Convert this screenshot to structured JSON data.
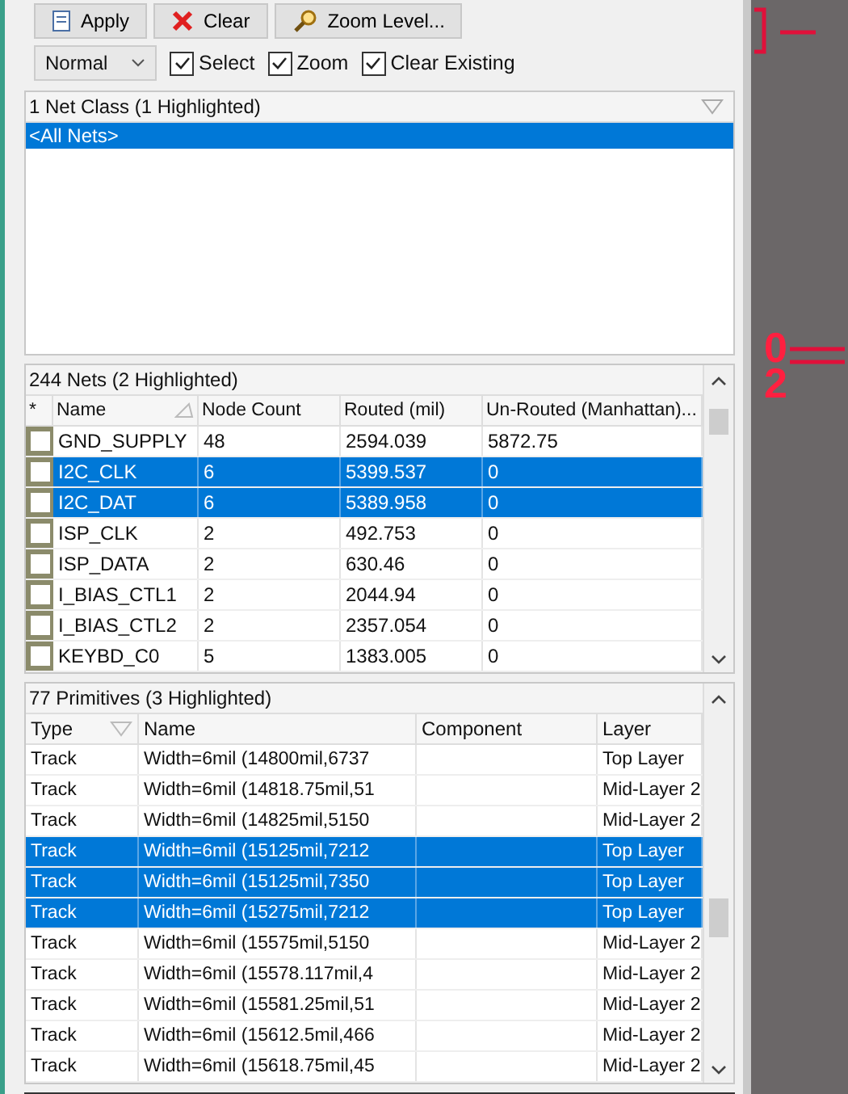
{
  "toolbar": {
    "buttons": [
      {
        "label": "Apply",
        "kind": "apply"
      },
      {
        "label": "Clear",
        "kind": "clear"
      },
      {
        "label": "Zoom Level...",
        "kind": "zoom"
      }
    ]
  },
  "options": {
    "mode": "Normal",
    "checkboxes": [
      {
        "label": "Select",
        "checked": true
      },
      {
        "label": "Zoom",
        "checked": true
      },
      {
        "label": "Clear Existing",
        "checked": true
      }
    ]
  },
  "net_classes": {
    "header": "1 Net Class (1 Highlighted)",
    "items": [
      {
        "name": "<All Nets>",
        "selected": true
      }
    ]
  },
  "nets": {
    "header": "244 Nets (2 Highlighted)",
    "check_column": "*",
    "columns": [
      {
        "label": "Name",
        "sorted": true
      },
      {
        "label": "Node Count",
        "sorted": false
      },
      {
        "label": "Routed (mil)",
        "sorted": false
      },
      {
        "label": "Un-Routed (Manhattan)...",
        "sorted": false
      }
    ],
    "rows": [
      {
        "checked": false,
        "selected": false,
        "cells": [
          "GND_SUPPLY",
          "48",
          "2594.039",
          "5872.75"
        ]
      },
      {
        "checked": false,
        "selected": true,
        "cells": [
          "I2C_CLK",
          "6",
          "5399.537",
          "0"
        ]
      },
      {
        "checked": false,
        "selected": true,
        "cells": [
          "I2C_DAT",
          "6",
          "5389.958",
          "0"
        ]
      },
      {
        "checked": false,
        "selected": false,
        "cells": [
          "ISP_CLK",
          "2",
          "492.753",
          "0"
        ]
      },
      {
        "checked": false,
        "selected": false,
        "cells": [
          "ISP_DATA",
          "2",
          "630.46",
          "0"
        ]
      },
      {
        "checked": false,
        "selected": false,
        "cells": [
          "I_BIAS_CTL1",
          "2",
          "2044.94",
          "0"
        ]
      },
      {
        "checked": false,
        "selected": false,
        "cells": [
          "I_BIAS_CTL2",
          "2",
          "2357.054",
          "0"
        ]
      },
      {
        "checked": false,
        "selected": false,
        "cells": [
          "KEYBD_C0",
          "5",
          "1383.005",
          "0"
        ]
      }
    ]
  },
  "primitives": {
    "header": "77 Primitives (3 Highlighted)",
    "columns": [
      {
        "label": "Type",
        "sorted": true
      },
      {
        "label": "Name",
        "sorted": false
      },
      {
        "label": "Component",
        "sorted": false
      },
      {
        "label": "Layer",
        "sorted": false
      }
    ],
    "rows": [
      {
        "selected": false,
        "cells": [
          "Track",
          "Width=6mil (14800mil,6737",
          "",
          "Top Layer"
        ]
      },
      {
        "selected": false,
        "cells": [
          "Track",
          "Width=6mil (14818.75mil,51",
          "",
          "Mid-Layer 2"
        ]
      },
      {
        "selected": false,
        "cells": [
          "Track",
          "Width=6mil (14825mil,5150",
          "",
          "Mid-Layer 2"
        ]
      },
      {
        "selected": true,
        "cells": [
          "Track",
          "Width=6mil (15125mil,7212",
          "",
          "Top Layer"
        ]
      },
      {
        "selected": true,
        "cells": [
          "Track",
          "Width=6mil (15125mil,7350",
          "",
          "Top Layer"
        ]
      },
      {
        "selected": true,
        "cells": [
          "Track",
          "Width=6mil (15275mil,7212",
          "",
          "Top Layer"
        ]
      },
      {
        "selected": false,
        "cells": [
          "Track",
          "Width=6mil (15575mil,5150",
          "",
          "Mid-Layer 2"
        ]
      },
      {
        "selected": false,
        "cells": [
          "Track",
          "Width=6mil (15578.117mil,4",
          "",
          "Mid-Layer 2"
        ]
      },
      {
        "selected": false,
        "cells": [
          "Track",
          "Width=6mil (15581.25mil,51",
          "",
          "Mid-Layer 2"
        ]
      },
      {
        "selected": false,
        "cells": [
          "Track",
          "Width=6mil (15612.5mil,466",
          "",
          "Mid-Layer 2"
        ]
      },
      {
        "selected": false,
        "cells": [
          "Track",
          "Width=6mil (15618.75mil,45",
          "",
          "Mid-Layer 2"
        ]
      }
    ]
  },
  "canvas": {
    "labels": [
      "0",
      "2"
    ]
  }
}
